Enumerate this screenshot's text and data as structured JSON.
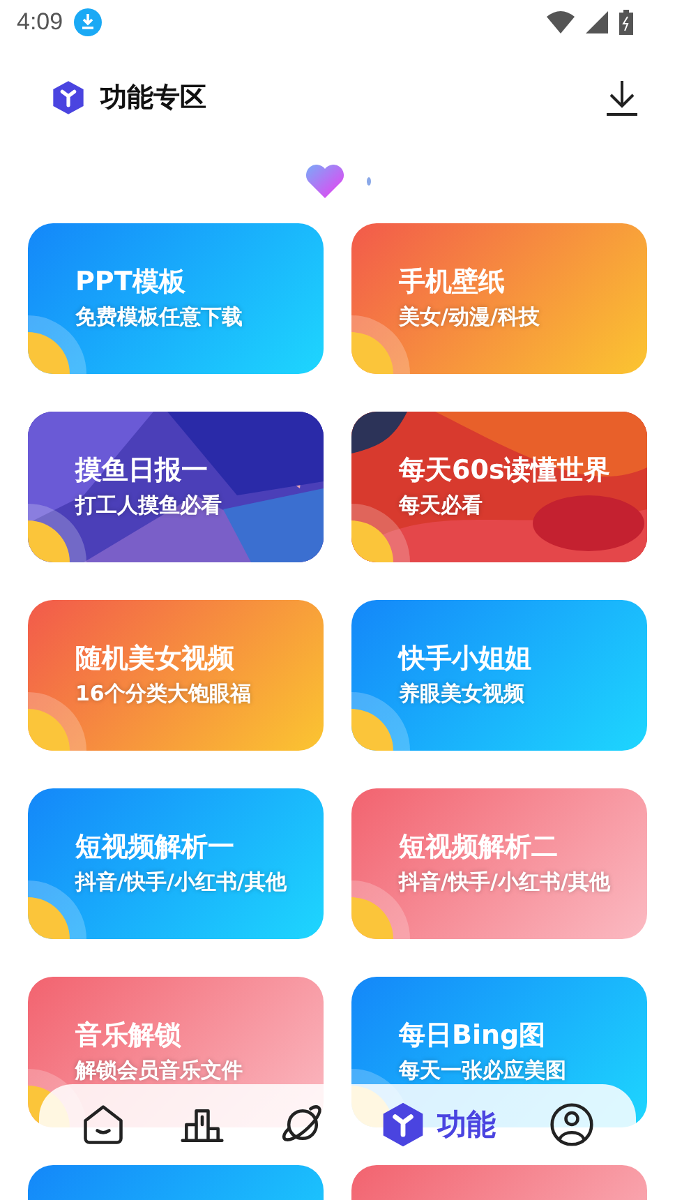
{
  "status_bar": {
    "time": "4:09"
  },
  "header": {
    "title": "功能专区"
  },
  "cards": [
    {
      "kind": "gradient",
      "color": "#1487f9",
      "title": "PPT模板",
      "subtitle": "免费模板任意下载"
    },
    {
      "kind": "gradient",
      "color": "#f25a4b",
      "title": "手机壁纸",
      "subtitle": "美女/动漫/科技"
    },
    {
      "kind": "picture",
      "color": "#4b3fb8",
      "title": "摸鱼日报一",
      "subtitle": "打工人摸鱼必看"
    },
    {
      "kind": "picture",
      "color": "#d83a2e",
      "title": "每天60s读懂世界",
      "subtitle": "每天必看"
    },
    {
      "kind": "gradient",
      "color": "#f25a4b",
      "title": "随机美女视频",
      "subtitle": "16个分类大饱眼福"
    },
    {
      "kind": "gradient",
      "color": "#1487f9",
      "title": "快手小姐姐",
      "subtitle": "养眼美女视频"
    },
    {
      "kind": "gradient",
      "color": "#1487f9",
      "title": "短视频解析一",
      "subtitle": "抖音/快手/小红书/其他"
    },
    {
      "kind": "gradient",
      "color": "#f2636f",
      "title": "短视频解析二",
      "subtitle": "抖音/快手/小红书/其他"
    },
    {
      "kind": "gradient",
      "color": "#f2636f",
      "title": "音乐解锁",
      "subtitle": "解锁会员音乐文件"
    },
    {
      "kind": "gradient",
      "color": "#1487f9",
      "title": "每日Bing图",
      "subtitle": "每天一张必应美图"
    },
    {
      "kind": "gradient",
      "color": "#1487f9"
    },
    {
      "kind": "gradient",
      "color": "#f2636f"
    }
  ],
  "nav": [
    {
      "kind": "home",
      "selected": false
    },
    {
      "kind": "rank",
      "selected": false
    },
    {
      "kind": "planet",
      "selected": false
    },
    {
      "kind": "feature",
      "selected": true,
      "label": "功能"
    },
    {
      "kind": "profile",
      "selected": false
    }
  ]
}
